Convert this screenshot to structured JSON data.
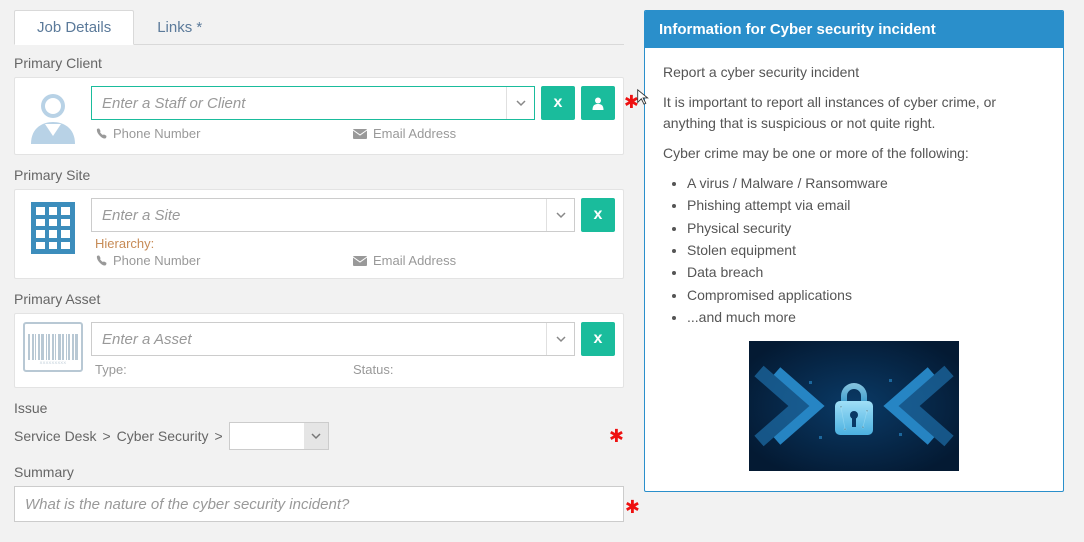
{
  "tabs": {
    "jobDetails": "Job Details",
    "links": "Links *"
  },
  "primaryClient": {
    "label": "Primary Client",
    "placeholder": "Enter a Staff or Client",
    "phoneLabel": "Phone Number",
    "emailLabel": "Email Address"
  },
  "primarySite": {
    "label": "Primary Site",
    "placeholder": "Enter a Site",
    "hierarchyLabel": "Hierarchy:",
    "phoneLabel": "Phone Number",
    "emailLabel": "Email Address",
    "clearX": "x"
  },
  "primaryAsset": {
    "label": "Primary Asset",
    "placeholder": "Enter a Asset",
    "typeLabel": "Type:",
    "statusLabel": "Status:",
    "clearX": "x"
  },
  "issue": {
    "label": "Issue",
    "crumb1": "Service Desk",
    "crumb2": "Cyber Security",
    "sep": ">"
  },
  "summary": {
    "label": "Summary",
    "placeholder": "What is the nature of the cyber security incident?"
  },
  "buttons": {
    "clearX": "x"
  },
  "info": {
    "header": "Information for Cyber security incident",
    "p1": "Report a cyber security incident",
    "p2": "It is important to report all instances of cyber crime, or anything that is suspicious or not quite right.",
    "p3": "Cyber crime may be one or more of the following:",
    "items": [
      "A virus / Malware / Ransomware",
      "Phishing attempt via email",
      "Physical security",
      "Stolen equipment",
      "Data breach",
      "Compromised applications",
      "...and much more"
    ]
  }
}
